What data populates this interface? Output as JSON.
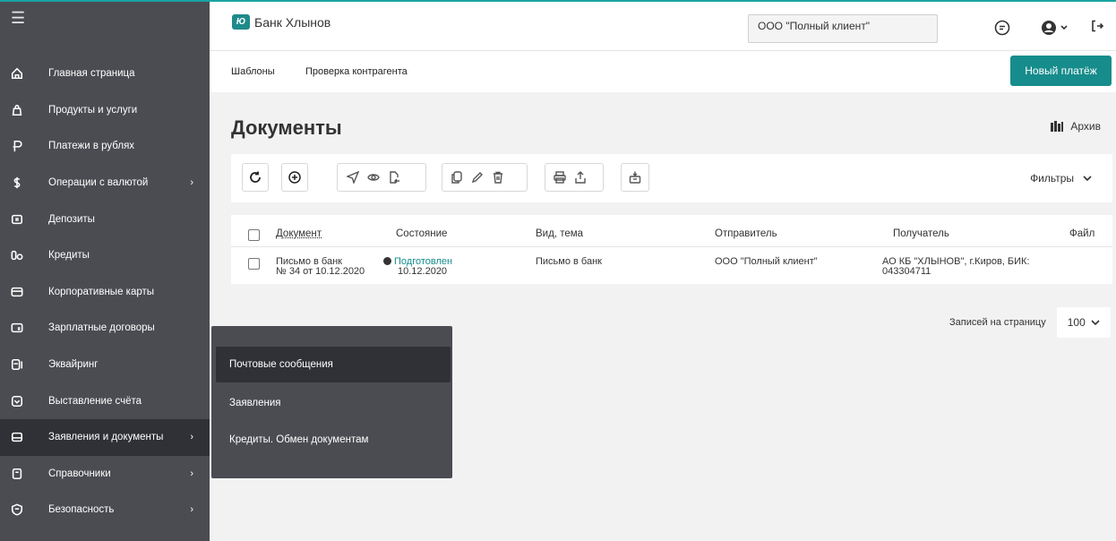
{
  "colors": {
    "accent": "#178c8c",
    "sidebar": "#4a4c52",
    "sidebar_active": "#2f3136"
  },
  "sidebar": {
    "items": [
      {
        "label": "Главная страница",
        "icon": "home-icon",
        "chevron": false
      },
      {
        "label": "Продукты и услуги",
        "icon": "bag-icon",
        "chevron": false
      },
      {
        "label": "Платежи в рублях",
        "icon": "ruble-icon",
        "chevron": false
      },
      {
        "label": "Операции с валютой",
        "icon": "dollar-icon",
        "chevron": true
      },
      {
        "label": "Депозиты",
        "icon": "deposit-icon",
        "chevron": false
      },
      {
        "label": "Кредиты",
        "icon": "credit-icon",
        "chevron": false
      },
      {
        "label": "Корпоративные карты",
        "icon": "card-icon",
        "chevron": false
      },
      {
        "label": "Зарплатные договоры",
        "icon": "salary-icon",
        "chevron": false
      },
      {
        "label": "Эквайринг",
        "icon": "acquiring-icon",
        "chevron": false
      },
      {
        "label": "Выставление счёта",
        "icon": "invoice-icon",
        "chevron": false
      },
      {
        "label": "Заявления и документы",
        "icon": "folder-icon",
        "chevron": true
      },
      {
        "label": "Справочники",
        "icon": "book-icon",
        "chevron": true
      },
      {
        "label": "Безопасность",
        "icon": "shield-icon",
        "chevron": true
      }
    ]
  },
  "header": {
    "bank_name": "Банк Хлынов",
    "logo_mark": "Ю",
    "client": "ООО \"Полный клиент\""
  },
  "subnav": {
    "templates": "Шаблоны",
    "check": "Проверка контрагента",
    "new_payment": "Новый платёж"
  },
  "page": {
    "title": "Документы",
    "archive": "Архив",
    "filters": "Фильтры"
  },
  "table": {
    "headers": [
      "Документ",
      "Состояние",
      "Вид, тема",
      "Отправитель",
      "Получатель",
      "Файл"
    ],
    "rows": [
      {
        "doc_line1": "Письмо в банк",
        "doc_line2": "№ 34 от 10.12.2020",
        "status": "Подготовлен",
        "status_date": "10.12.2020",
        "type": "Письмо в банк",
        "sender": "ООО \"Полный клиент\"",
        "recipient_line1": "АО КБ \"ХЛЫНОВ\", г.Киров, БИК:",
        "recipient_line2": "043304711"
      }
    ]
  },
  "pagination": {
    "label": "Записей на страницу",
    "value": "100"
  },
  "flyout": {
    "items": [
      "Почтовые сообщения",
      "Заявления",
      "Кредиты. Обмен документам"
    ]
  }
}
